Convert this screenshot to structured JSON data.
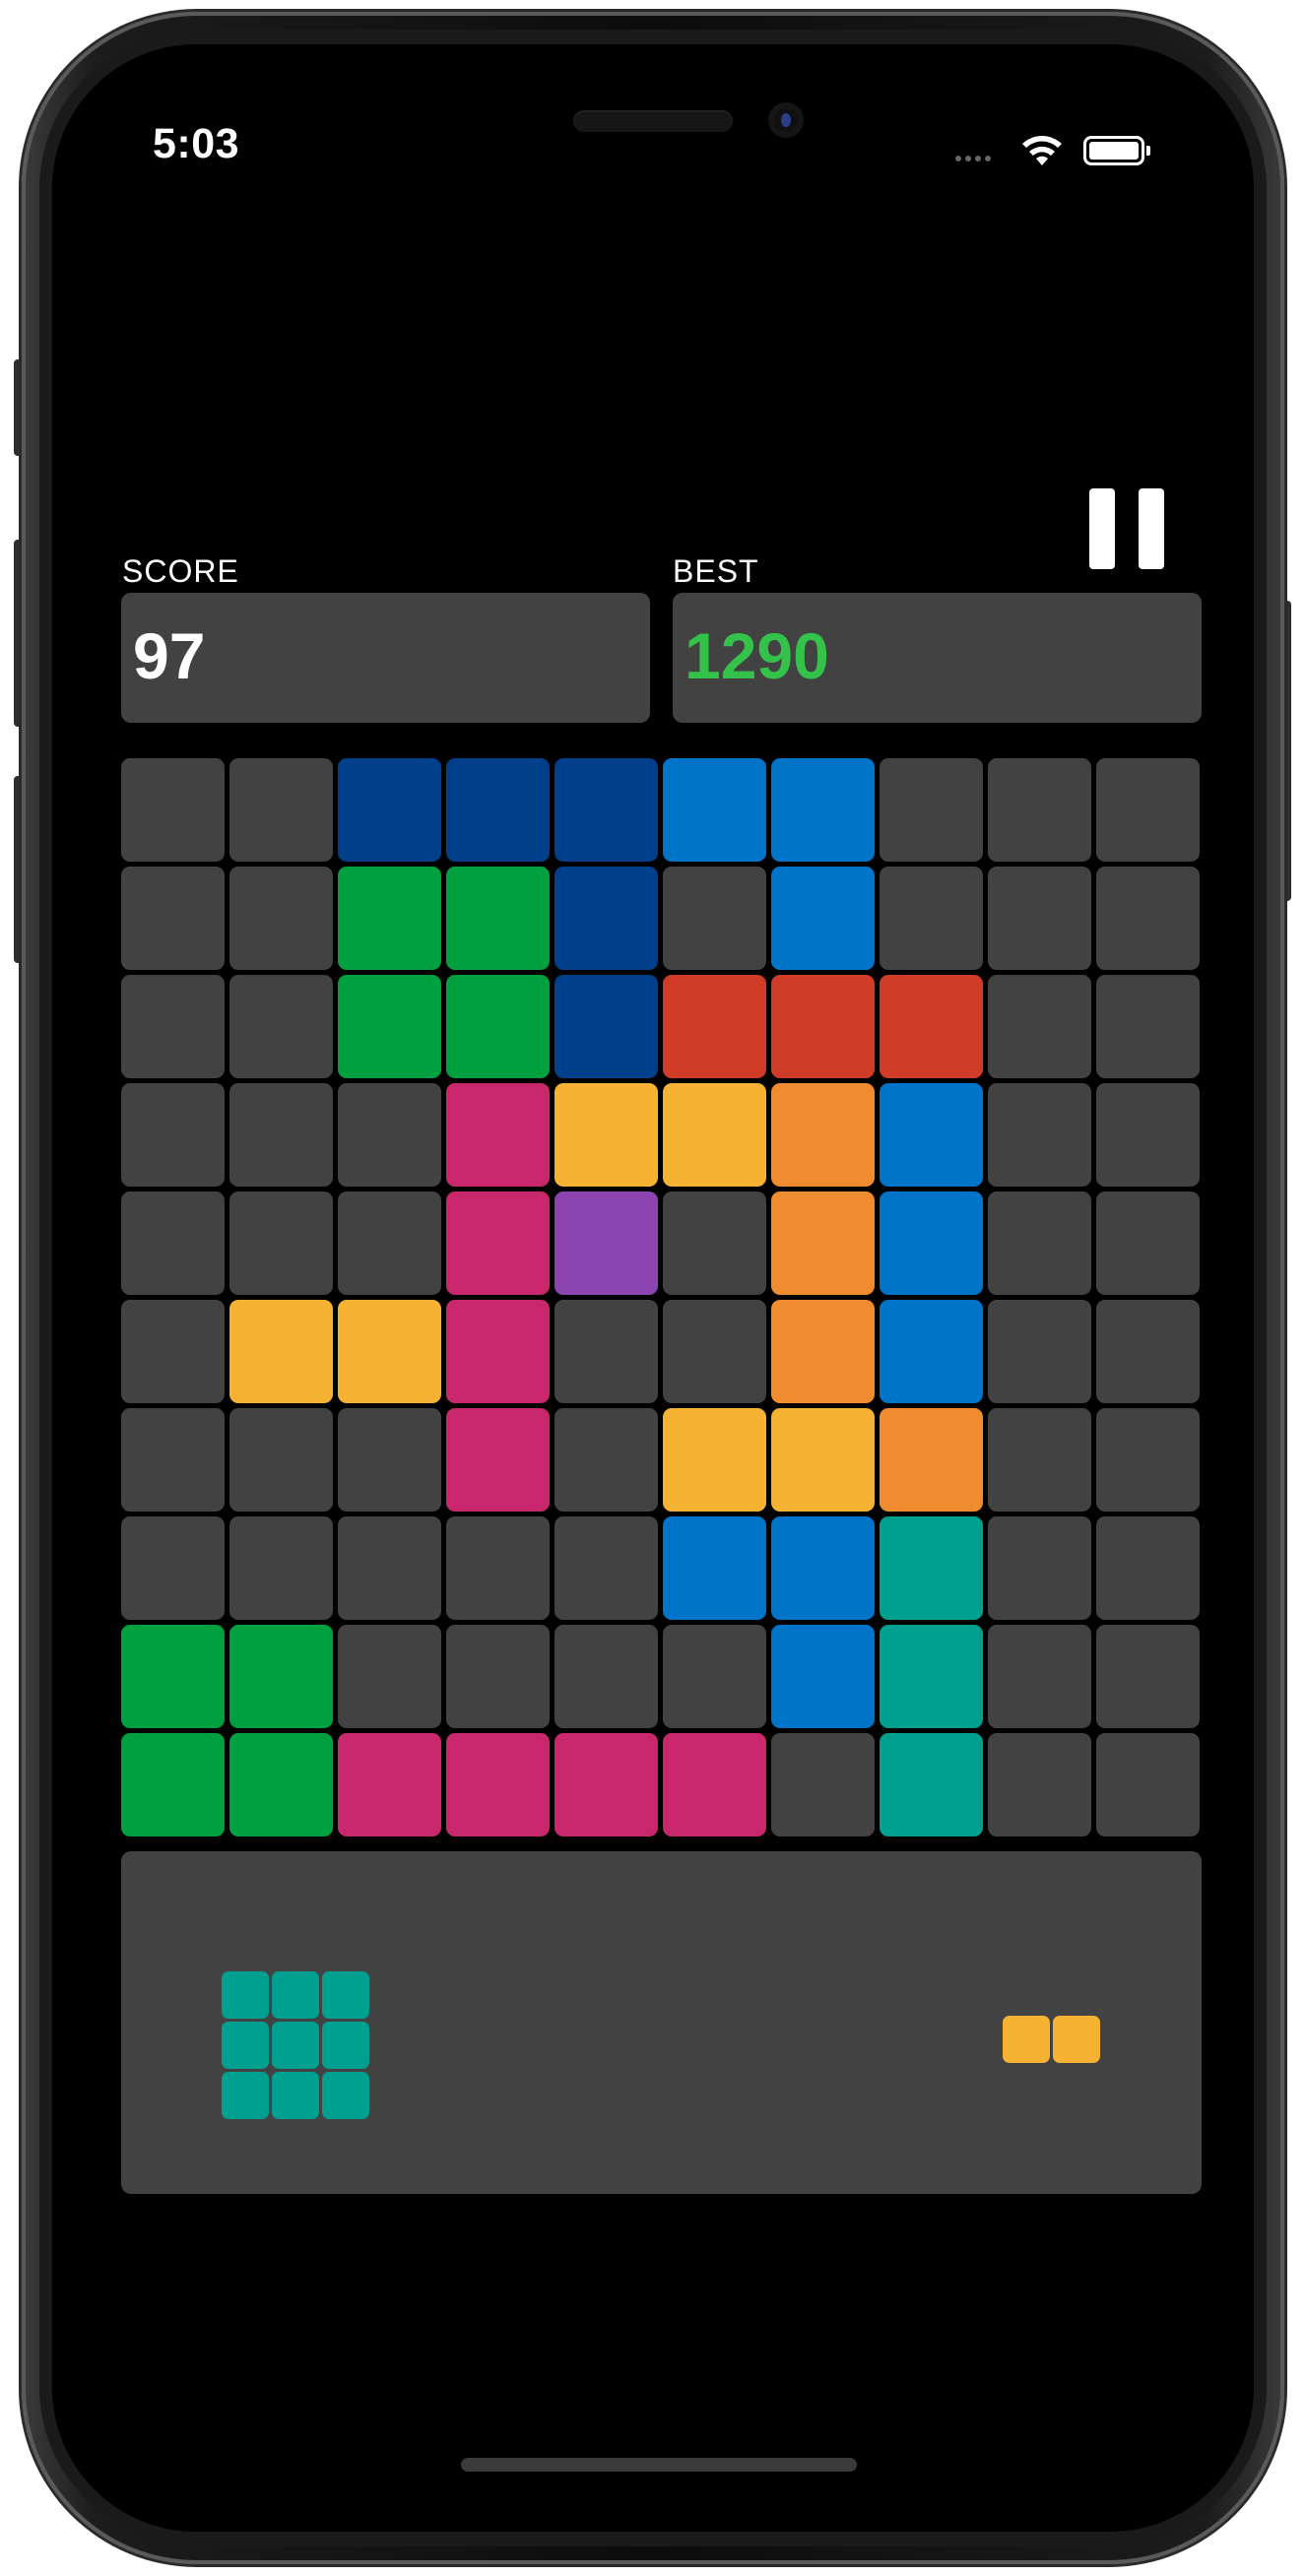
{
  "status_bar": {
    "time": "5:03"
  },
  "score": {
    "label": "SCORE",
    "value": "97"
  },
  "best": {
    "label": "BEST",
    "value": "1290"
  },
  "colors": {
    "empty": "#424242",
    "navy": "#003f8a",
    "blue": "#0074c8",
    "green": "#00a040",
    "red": "#d13c28",
    "pink": "#c8286b",
    "yellow": "#f6b232",
    "orange": "#ef8c30",
    "purple": "#8c44b0",
    "teal": "#00a091",
    "best_text": "#35c24a"
  },
  "board": {
    "rows": [
      [
        "empty",
        "empty",
        "navy",
        "navy",
        "navy",
        "blue",
        "blue",
        "empty",
        "empty",
        "empty"
      ],
      [
        "empty",
        "empty",
        "green",
        "green",
        "navy",
        "empty",
        "blue",
        "empty",
        "empty",
        "empty"
      ],
      [
        "empty",
        "empty",
        "green",
        "green",
        "navy",
        "red",
        "red",
        "red",
        "empty",
        "empty"
      ],
      [
        "empty",
        "empty",
        "empty",
        "pink",
        "yellow",
        "yellow",
        "orange",
        "blue",
        "empty",
        "empty"
      ],
      [
        "empty",
        "empty",
        "empty",
        "pink",
        "purple",
        "empty",
        "orange",
        "blue",
        "empty",
        "empty"
      ],
      [
        "empty",
        "yellow",
        "yellow",
        "pink",
        "empty",
        "empty",
        "orange",
        "blue",
        "empty",
        "empty"
      ],
      [
        "empty",
        "empty",
        "empty",
        "pink",
        "empty",
        "yellow",
        "yellow",
        "orange",
        "empty",
        "empty"
      ],
      [
        "empty",
        "empty",
        "empty",
        "empty",
        "empty",
        "blue",
        "blue",
        "teal",
        "empty",
        "empty"
      ],
      [
        "green",
        "green",
        "empty",
        "empty",
        "empty",
        "empty",
        "blue",
        "teal",
        "empty",
        "empty"
      ],
      [
        "green",
        "green",
        "pink",
        "pink",
        "pink",
        "pink",
        "empty",
        "teal",
        "empty",
        "empty"
      ]
    ]
  },
  "tray": {
    "pieces": [
      {
        "name": "piece-teal-3x3",
        "color": "teal",
        "rows": 3,
        "cols": 3
      },
      {
        "name": "piece-yellow-1x2",
        "color": "yellow",
        "rows": 1,
        "cols": 2
      }
    ]
  },
  "icons": {
    "pause": "pause-icon",
    "wifi": "wifi-icon",
    "battery": "battery-icon"
  }
}
